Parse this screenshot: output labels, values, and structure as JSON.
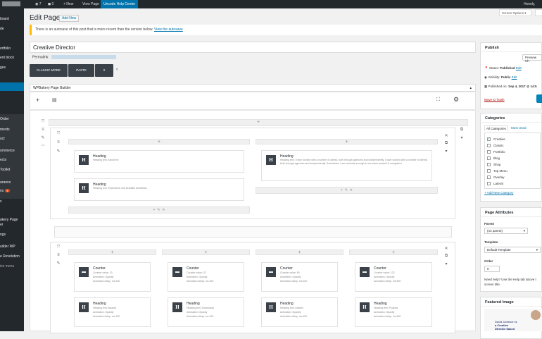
{
  "admin_bar": {
    "items": [
      "◉ 7",
      "◼ 0",
      "+ New",
      "View Page"
    ],
    "highlight": "Uncode Help Center",
    "howdy": "Howdy,"
  },
  "sidebar": {
    "items": [
      "board",
      "de",
      "",
      "ortfolio",
      "ent block",
      "ges",
      "",
      "",
      "",
      "Order",
      "ments",
      "uct",
      "",
      "ommerce",
      "ects",
      "Toolkit",
      "",
      "arance",
      "ns",
      "",
      "s",
      "",
      "akery Page",
      "er",
      "ngs",
      "uilder WP",
      "e Revolution",
      "ise menu"
    ],
    "badge": "4"
  },
  "header": {
    "title": "Edit Page",
    "add_new": "Add New",
    "screen_options": "Screen Options ▾"
  },
  "notice": {
    "text": "There is an autosave of this post that is more recent than the version below.",
    "link": "View the autosave"
  },
  "post_title": "Creative Director",
  "permalink_label": "Permalink:",
  "modes": [
    "CLASSIC MODE",
    "PASTE",
    "0"
  ],
  "builder": {
    "title": "WPBakery Page Builder",
    "row1": {
      "col1": [
        {
          "icon": "H",
          "title": "Heading",
          "desc": "Heading text: About me"
        },
        {
          "icon": "H",
          "title": "Heading",
          "desc": "Heading text: Experience and beautiful aesthetics"
        }
      ],
      "col2": [
        {
          "icon": "H",
          "title": "Heading",
          "desc": "Heading text: I have worked with a number of clients, both through agencies and independently. I have worked with a number of clients, both through agencies and independently. Sometimes, I am fortunate enough to win some awards & recognition"
        }
      ]
    },
    "row2": {
      "counters": [
        {
          "icon": "▬",
          "title": "Counter",
          "desc": [
            "Counter value: 13",
            "Animation: Opacity",
            "Animation delay: ms 200"
          ]
        },
        {
          "icon": "▬",
          "title": "Counter",
          "desc": [
            "Counter value: 22",
            "Animation: Opacity",
            "Animation delay: ms 300"
          ]
        },
        {
          "icon": "▬",
          "title": "Counter",
          "desc": [
            "Counter value: 60",
            "Animation: Opacity",
            "Animation delay: ms 400"
          ]
        },
        {
          "icon": "▬",
          "title": "Counter",
          "desc": [
            "Counter value: 122",
            "Animation: Opacity",
            "Animation delay: ms 500"
          ]
        }
      ],
      "headings": [
        {
          "icon": "H",
          "title": "Heading",
          "desc": [
            "Heading text: Awards",
            "Animation: Opacity",
            "Animation delay: ms 200"
          ]
        },
        {
          "icon": "H",
          "title": "Heading",
          "desc": [
            "Heading text: Downloads",
            "Animation: Opacity",
            "Animation delay: ms 300"
          ]
        },
        {
          "icon": "H",
          "title": "Heading",
          "desc": [
            "Heading text: Articles",
            "Animation: Opacity",
            "Animation delay: ms 400"
          ]
        },
        {
          "icon": "H",
          "title": "Heading",
          "desc": [
            "Heading text: Projects",
            "Animation: Opacity",
            "Animation delay: ms 500"
          ]
        }
      ]
    }
  },
  "publish": {
    "title": "Publish",
    "preview": "Preview Ch",
    "status_label": "Status:",
    "status_value": "Published",
    "visibility_label": "Visibility:",
    "visibility_value": "Public",
    "published_label": "Published on:",
    "published_value": "Sep 4, 2017 @ 14:5",
    "edit": "Edit",
    "trash": "Move to Trash"
  },
  "categories": {
    "title": "Categories",
    "tab_all": "All Categories",
    "tab_used": "Most Used",
    "items": [
      "Creative",
      "Classic",
      "Portfolio",
      "Blog",
      "Shop",
      "Top Menu",
      "Overlay",
      "Lateral"
    ],
    "checked_index": 0,
    "add_new": "+ Add New Category"
  },
  "page_attributes": {
    "title": "Page Attributes",
    "parent_label": "Parent",
    "parent_value": "(no parent)",
    "template_label": "Template",
    "template_value": "Default Template",
    "order_label": "Order",
    "order_value": "0",
    "help": "Need help? Use the Help tab above t",
    "help2": "screen title."
  },
  "featured": {
    "title": "Featured Image",
    "caption1": "David Jameson is",
    "caption2": "a Creative",
    "caption3": "Director based"
  },
  "colors": {
    "accent": "#0073aa",
    "dark": "#23282d",
    "notice": "#ffb900"
  }
}
